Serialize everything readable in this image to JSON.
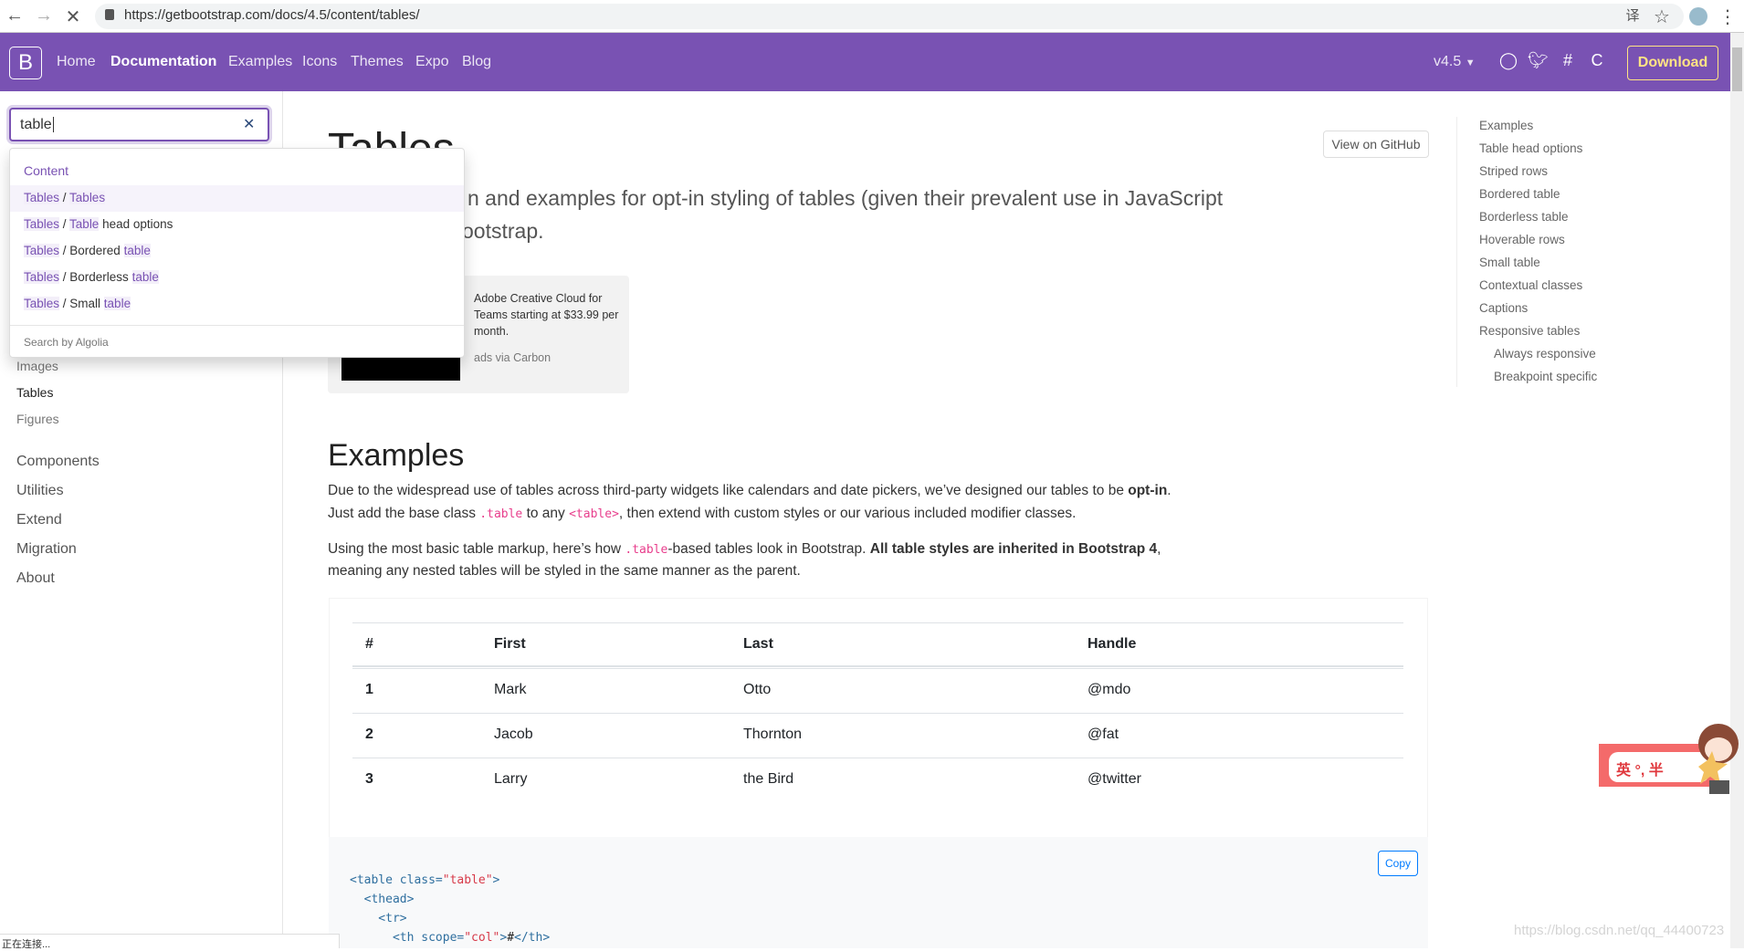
{
  "browser": {
    "url": "https://getbootstrap.com/docs/4.5/content/tables/",
    "status": "正在连接..."
  },
  "navbar": {
    "brand": "B",
    "links": [
      "Home",
      "Documentation",
      "Examples",
      "Icons",
      "Themes",
      "Expo",
      "Blog"
    ],
    "active": "Documentation",
    "version": "v4.5",
    "download": "Download",
    "accent": "#7952b3",
    "download_color": "#ffe484"
  },
  "search": {
    "value": "table",
    "dropdown": {
      "category": "Content",
      "suggestions": [
        [
          {
            "t": "Tables",
            "m": true
          },
          {
            "t": " / "
          },
          {
            "t": "Tables",
            "m": true
          }
        ],
        [
          {
            "t": "Tables",
            "m": true
          },
          {
            "t": " / "
          },
          {
            "t": "Table",
            "m": true
          },
          {
            "t": " head options"
          }
        ],
        [
          {
            "t": "Tables",
            "m": true
          },
          {
            "t": " / Bordered "
          },
          {
            "t": "table",
            "m": true
          }
        ],
        [
          {
            "t": "Tables",
            "m": true
          },
          {
            "t": " / Borderless "
          },
          {
            "t": "table",
            "m": true
          }
        ],
        [
          {
            "t": "Tables",
            "m": true
          },
          {
            "t": " / Small "
          },
          {
            "t": "table",
            "m": true
          }
        ]
      ],
      "footer": "Search by Algolia"
    }
  },
  "sidebar": {
    "items": [
      "Images",
      "Tables",
      "Figures"
    ],
    "groups": [
      "Components",
      "Utilities",
      "Extend",
      "Migration",
      "About"
    ]
  },
  "page": {
    "title": "Tables",
    "lead1": "n and examples for opt-in styling of tables (given their prevalent use in JavaScript",
    "lead2": "ootstrap.",
    "view_github": "View on GitHub",
    "ad": {
      "text": "Adobe Creative Cloud for Teams starting at $33.99 per month.",
      "via": "ads via Carbon"
    },
    "examples_heading": "Examples",
    "p1a": "Due to the widespread use of tables across third-party widgets like calendars and date pickers, we’ve designed our tables to be ",
    "p1b": "opt-in",
    "p2a": "Just add the base class ",
    "p2code1": ".table",
    "p2b": " to any ",
    "p2code2": "<table>",
    "p2c": ", then extend with custom styles or our various included modifier classes.",
    "p3a": "Using the most basic table markup, here’s how ",
    "p3code": ".table",
    "p3b": "-based tables look in Bootstrap. ",
    "p3bold": "All table styles are inherited in Bootstrap 4",
    "p3c": ",",
    "p4": "meaning any nested tables will be styled in the same manner as the parent."
  },
  "table": {
    "headers": [
      "#",
      "First",
      "Last",
      "Handle"
    ],
    "rows": [
      [
        "1",
        "Mark",
        "Otto",
        "@mdo"
      ],
      [
        "2",
        "Jacob",
        "Thornton",
        "@fat"
      ],
      [
        "3",
        "Larry",
        "the Bird",
        "@twitter"
      ]
    ]
  },
  "code": {
    "copy": "Copy",
    "lines": [
      [
        {
          "c": "<table class="
        },
        {
          "s": "\"table\""
        },
        {
          "c": ">"
        }
      ],
      [
        {
          "c": "  <thead>"
        }
      ],
      [
        {
          "c": "    <tr>"
        }
      ],
      [
        {
          "c": "      <th scope="
        },
        {
          "s": "\"col\""
        },
        {
          "c": ">"
        },
        {
          "t": "#"
        },
        {
          "c": "</th>"
        }
      ]
    ]
  },
  "toc": {
    "items": [
      "Examples",
      "Table head options",
      "Striped rows",
      "Bordered table",
      "Borderless table",
      "Hoverable rows",
      "Small table",
      "Contextual classes",
      "Captions",
      "Responsive tables"
    ],
    "sub": [
      "Always responsive",
      "Breakpoint specific"
    ]
  },
  "overlay": {
    "ime": "英 °, 半",
    "watermark": "https://blog.csdn.net/qq_44400723"
  }
}
